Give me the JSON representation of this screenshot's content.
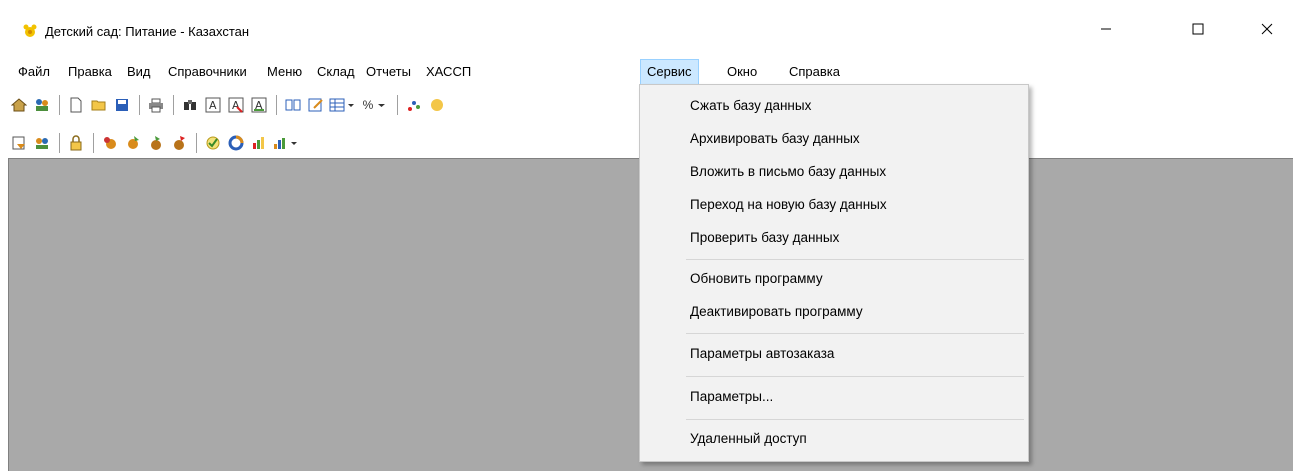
{
  "window": {
    "title": "Детский сад: Питание - Казахстан",
    "minimize_glyph": "—",
    "maximize_glyph": "☐",
    "close_glyph": "✕"
  },
  "menubar": {
    "items": [
      "Файл",
      "Правка",
      "Вид",
      "Справочники",
      "Меню",
      "Склад",
      "Отчеты",
      "ХАССП",
      "Сервис",
      "Окно",
      "Справка"
    ],
    "active": "Сервис"
  },
  "toolbar1": {
    "icons": [
      "home-icon",
      "users-icon",
      "new-document-icon",
      "open-folder-icon",
      "save-icon",
      "print-icon",
      "find-icon",
      "text-a-icon",
      "text-a-red-icon",
      "text-a-edit-icon",
      "book-icon",
      "edit-note-icon",
      "table-icon",
      "percent-icon",
      "chart-dots-icon"
    ],
    "percent_label": "%"
  },
  "toolbar2": {
    "icons": [
      "export-icon",
      "contacts-icon",
      "lock-icon",
      "food-icon",
      "food-2-icon",
      "food-3-icon",
      "food-4-icon",
      "check-icon",
      "donut-icon",
      "bars-3d-icon",
      "bar-chart-icon"
    ]
  },
  "service_menu": {
    "items": [
      "Сжать базу данных",
      "Архивировать базу данных",
      "Вложить в письмо базу данных",
      "Переход на новую базу данных",
      "Проверить базу данных",
      "Обновить программу",
      "Деактивировать программу",
      "Параметры автозаказа",
      "Параметры...",
      "Удаленный доступ"
    ]
  },
  "colors": {
    "workspace": "#a9a9a9",
    "menu_highlight": "#cce8ff",
    "menu_highlight_border": "#99d1ff",
    "dropdown_bg": "#f2f2f2"
  }
}
